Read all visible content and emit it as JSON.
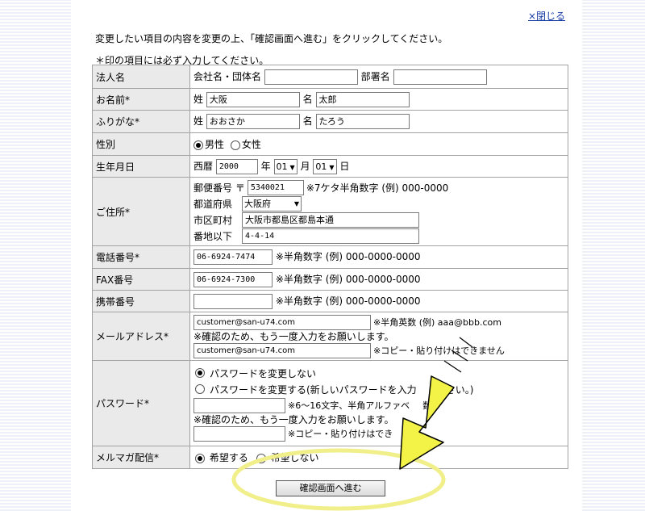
{
  "header": {
    "close_link": "×閉じる"
  },
  "intro_text": "変更したい項目の内容を変更の上、「確認画面へ進む」をクリックしてください。",
  "required_note": "＊印の項目には必ず入力してください。",
  "form": {
    "company": {
      "label": "法人名",
      "company_label": "会社名・団体名",
      "company_value": "",
      "dept_label": "部署名",
      "dept_value": ""
    },
    "name": {
      "label": "お名前*",
      "sei_label": "姓",
      "sei_value": "大阪",
      "mei_label": "名",
      "mei_value": "太郎"
    },
    "furigana": {
      "label": "ふりがな*",
      "sei_label": "姓",
      "sei_value": "おおさか",
      "mei_label": "名",
      "mei_value": "たろう"
    },
    "gender": {
      "label": "性別",
      "male": "男性",
      "female": "女性"
    },
    "birth": {
      "label": "生年月日",
      "era": "西暦",
      "year_value": "2000",
      "year_label": "年",
      "month_value": "01",
      "month_label": "月",
      "day_value": "01",
      "day_label": "日"
    },
    "address": {
      "label": "ご住所*",
      "zip_label": "郵便番号 〒",
      "zip_value": "5340021",
      "zip_hint": "※7ケタ半角数字 (例) 000-0000",
      "pref_label": "都道府県",
      "pref_value": "大阪府",
      "city_label": "市区町村",
      "city_value": "大阪市都島区都島本通",
      "street_label": "番地以下",
      "street_value": "4-4-14"
    },
    "phone": {
      "label": "電話番号*",
      "value": "06-6924-7474",
      "hint": "※半角数字 (例) 000-0000-0000"
    },
    "fax": {
      "label": "FAX番号",
      "value": "06-6924-7300",
      "hint": "※半角数字 (例) 000-0000-0000"
    },
    "mobile": {
      "label": "携帯番号",
      "value": "",
      "hint": "※半角数字 (例) 000-0000-0000"
    },
    "email": {
      "label": "メールアドレス*",
      "value": "customer@san-u74.com",
      "hint": "※半角英数 (例) aaa@bbb.com",
      "confirm_note": "※確認のため、もう一度入力をお願いします。",
      "confirm_value": "customer@san-u74.com",
      "confirm_hint": "※コピー・貼り付けはできません"
    },
    "password": {
      "label": "パスワード*",
      "keep": "パスワードを変更しない",
      "change": "パスワードを変更する(新しいパスワードを入力",
      "change_tail": "さい。)",
      "hint": "※6～16文字、半角アルファベ",
      "hint_tail": "数字",
      "confirm_note": "※確認のため、もう一度入力をお願いします。",
      "confirm_hint": "※コピー・貼り付けはでき"
    },
    "newsletter": {
      "label": "メルマガ配信*",
      "yes": "希望する",
      "no": "希望しない"
    }
  },
  "submit_label": "確認画面へ進む",
  "colors": {
    "arrow_fill": "#f2f247",
    "ellipse": "#f0ef8a",
    "link": "#1a3ea8"
  }
}
